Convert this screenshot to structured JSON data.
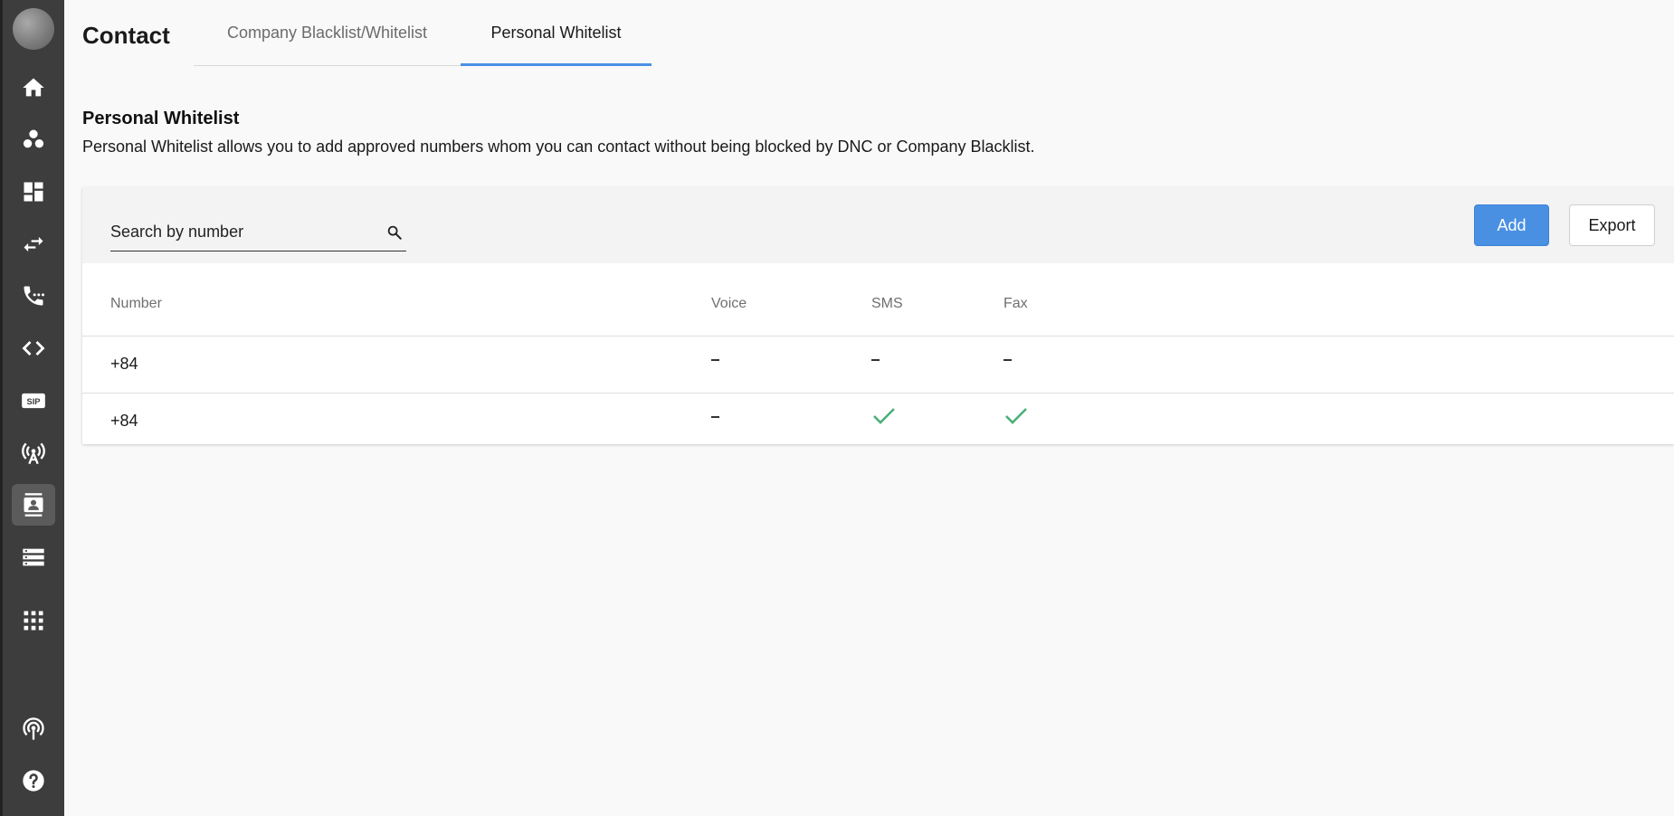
{
  "header": {
    "title": "Contact",
    "tabs": [
      {
        "label": "Company Blacklist/Whitelist",
        "active": false
      },
      {
        "label": "Personal Whitelist",
        "active": true
      }
    ]
  },
  "section": {
    "title": "Personal Whitelist",
    "description": "Personal Whitelist allows you to add approved numbers whom you can contact without being blocked by DNC or Company Blacklist."
  },
  "toolbar": {
    "search_placeholder": "Search by number",
    "add_label": "Add",
    "export_label": "Export"
  },
  "table": {
    "columns": [
      "Number",
      "Voice",
      "SMS",
      "Fax"
    ],
    "rows": [
      {
        "number": "+84",
        "voice": false,
        "sms": false,
        "fax": false
      },
      {
        "number": "+84",
        "voice": false,
        "sms": true,
        "fax": true
      }
    ]
  },
  "sidebar": {
    "items": [
      "home-icon",
      "users-icon",
      "dashboard-icon",
      "transfer-icon",
      "call-log-icon",
      "code-icon",
      "sip-icon",
      "antenna-icon",
      "contact-icon",
      "storage-icon",
      "apps-icon",
      "broadcast-icon",
      "help-icon"
    ],
    "active": "contact-icon"
  },
  "colors": {
    "accent": "#4a90e2",
    "check": "#4caf7a",
    "sidebar": "#3d3d3d"
  }
}
